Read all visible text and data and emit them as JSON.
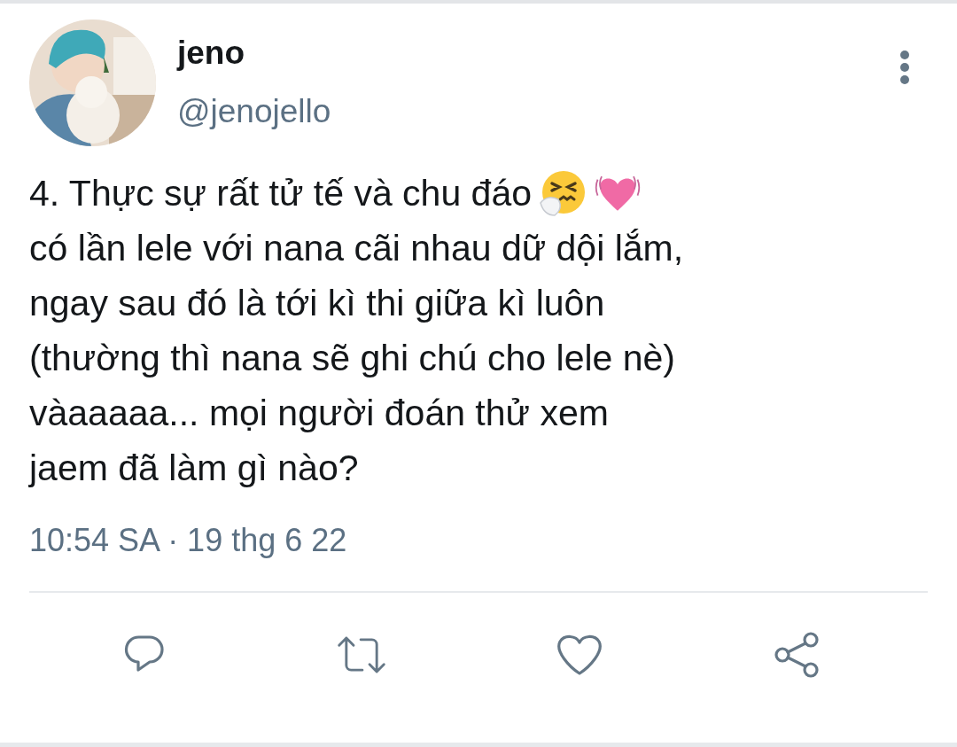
{
  "author": {
    "name": "jeno",
    "handle": "@jenojello"
  },
  "tweet": {
    "lines": [
      "4. Thực sự rất tử tế và chu đáo",
      "có lần lele với nana cãi nhau dữ dội lắm,",
      "ngay sau đó là tới kì thi giữa kì luôn",
      "(thường thì nana sẽ ghi chú cho lele nè)",
      "vàaaaaa... mọi người đoán thử xem",
      "jaem đã làm gì nào?"
    ],
    "timestamp": "10:54 SA · 19 thg 6 22"
  },
  "actions": [
    {
      "kind": "reply"
    },
    {
      "kind": "retweet"
    },
    {
      "kind": "like"
    },
    {
      "kind": "share"
    }
  ]
}
